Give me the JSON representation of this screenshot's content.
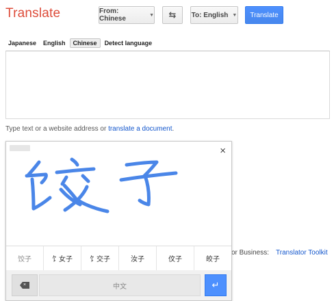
{
  "header": {
    "title": "Translate",
    "from_label": "From: Chinese",
    "swap_glyph": "⇆",
    "to_label": "To: English",
    "translate_label": "Translate"
  },
  "source_languages": [
    {
      "label": "Japanese",
      "active": false
    },
    {
      "label": "English",
      "active": false
    },
    {
      "label": "Chinese",
      "active": true
    },
    {
      "label": "Detect language",
      "active": false
    }
  ],
  "input": {
    "value": "",
    "tools": [
      "mic-icon",
      "pencil-icon",
      "dropdown-caret-icon",
      "keyboard-icon"
    ]
  },
  "hint": {
    "text": "Type text or a website address or ",
    "link": "translate a document",
    "end": "."
  },
  "business": {
    "text": "or Business:",
    "link": "Translator Toolkit"
  },
  "handwriting": {
    "close_glyph": "×",
    "candidates": [
      "饺子",
      "饣女子",
      "饣交子",
      "汝子",
      "伩子",
      "皎子"
    ],
    "space_label": "中文",
    "enter_glyph": "↵",
    "ink_color": "#4a86e8"
  },
  "colors": {
    "brand": "#dd4b39",
    "primary_button": "#4d90fe",
    "link": "#1155cc"
  }
}
